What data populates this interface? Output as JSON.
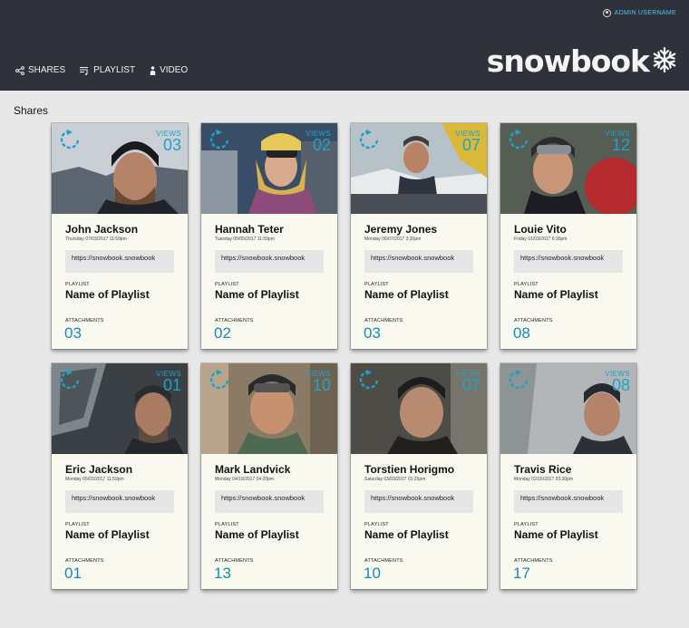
{
  "header": {
    "admin_label": "ADMIN USERNAME",
    "nav": [
      {
        "label": "SHARES",
        "icon": "share-icon"
      },
      {
        "label": "PLAYLIST",
        "icon": "playlist-icon"
      },
      {
        "label": "VIDEO",
        "icon": "person-icon"
      }
    ],
    "logo_text": "snowbook",
    "logo_icon": "snowflake-icon"
  },
  "page": {
    "section_title": "Shares"
  },
  "labels": {
    "views": "VIEWS",
    "playlist": "PLAYLIST",
    "attachments": "ATTACHMENTS"
  },
  "colors": {
    "header_bg": "#2f323a",
    "accent": "#1ea3c8",
    "card_bg": "#faf9f0"
  },
  "cards": [
    {
      "name": "John Jackson",
      "date": "Thursday 07/03/2017 11:59pm",
      "views": "03",
      "url": "https://snowbook.snowbook",
      "playlist": "Name of Playlist",
      "attachments": "03"
    },
    {
      "name": "Hannah Teter",
      "date": "Tuesday 05/05/2017 11:59pm",
      "views": "02",
      "url": "https://snowbook.snowbook",
      "playlist": "Name of Playlist",
      "attachments": "02"
    },
    {
      "name": "Jeremy Jones",
      "date": "Monday 06/07/2017 3:30pm",
      "views": "07",
      "url": "https://snowbook.snowbook",
      "playlist": "Name of Playlist",
      "attachments": "03"
    },
    {
      "name": "Louie Vito",
      "date": "Friday 01/03/2017 6:30pm",
      "views": "12",
      "url": "https://snowbook.snowbook",
      "playlist": "Name of Playlist",
      "attachments": "08"
    },
    {
      "name": "Eric Jackson",
      "date": "Monday 05/03/2017 11:59pm",
      "views": "01",
      "url": "https://snowbook.snowbook",
      "playlist": "Name of Playlist",
      "attachments": "01"
    },
    {
      "name": "Mark Landvick",
      "date": "Monday 04/19/2017 04:20pm",
      "views": "10",
      "url": "https://snowbook.snowbook",
      "playlist": "Name of Playlist",
      "attachments": "13"
    },
    {
      "name": "Torstien Horigmo",
      "date": "Saturday 03/03/2017 01:25pm",
      "views": "07",
      "url": "https://snowbook.snowbook",
      "playlist": "Name of Playlist",
      "attachments": "10"
    },
    {
      "name": "Travis Rice",
      "date": "Monday 02/15/2017 03:30pm",
      "views": "08",
      "url": "https://snowbook.snowbook",
      "playlist": "Name of Playlist",
      "attachments": "17"
    }
  ]
}
